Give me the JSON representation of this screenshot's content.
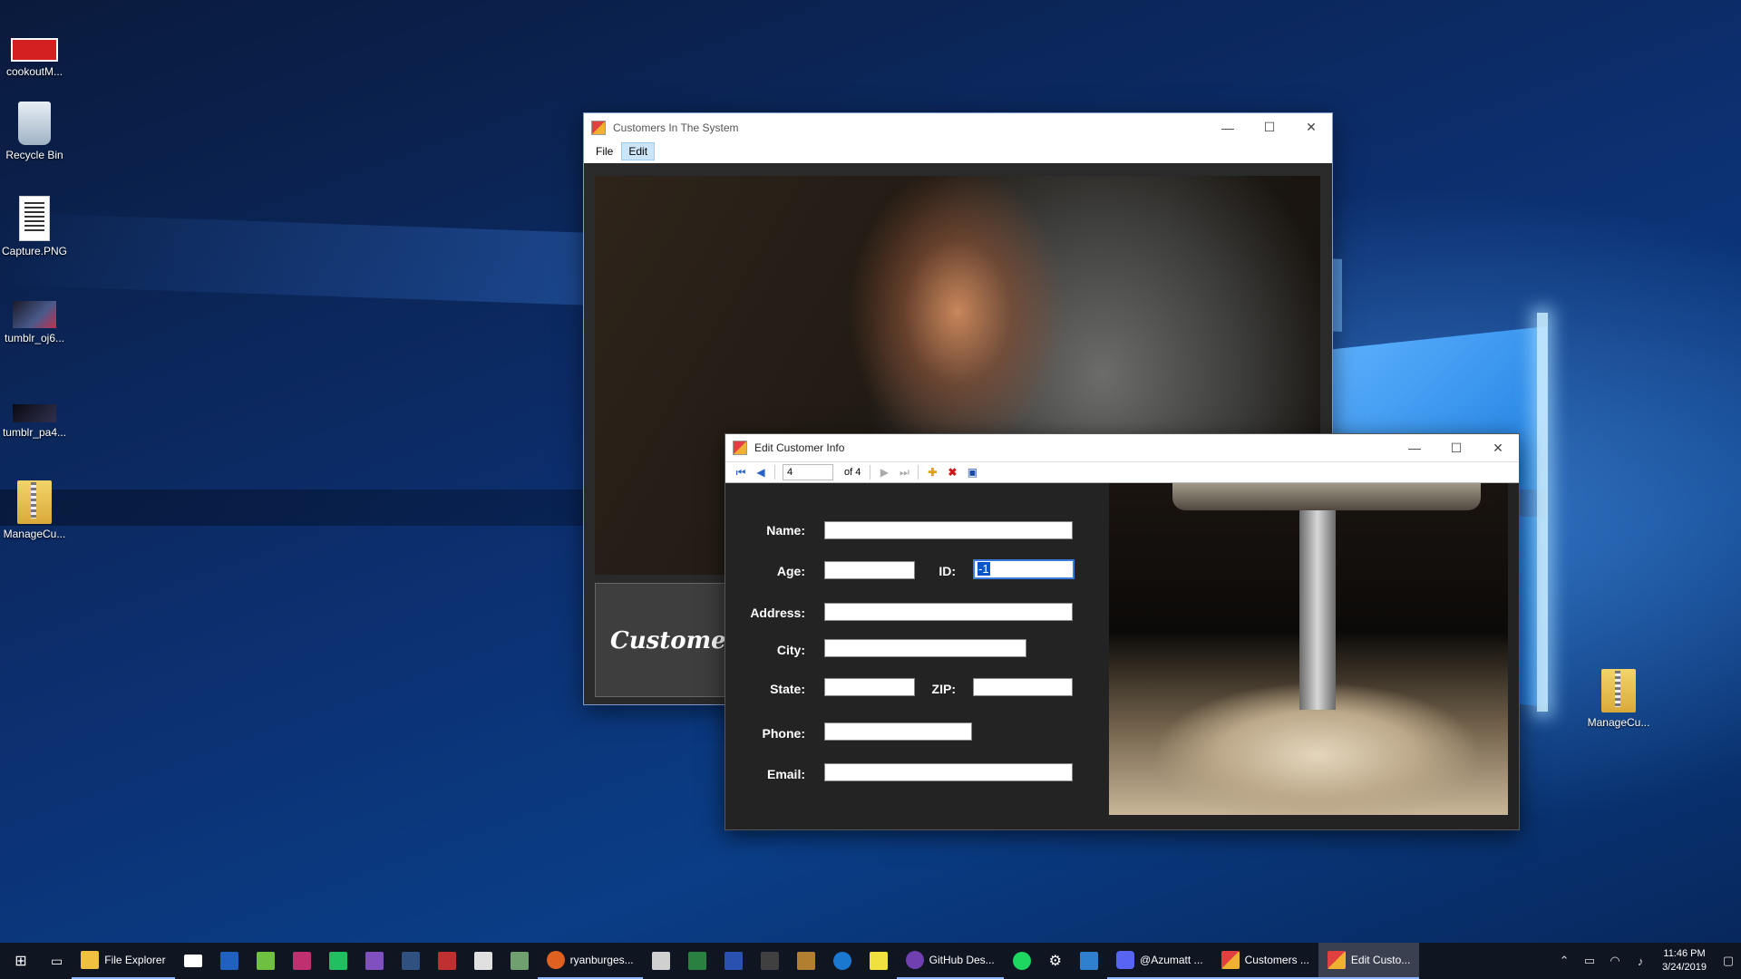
{
  "desktop": {
    "icons": [
      {
        "label": "cookoutM..."
      },
      {
        "label": "Recycle Bin"
      },
      {
        "label": "Capture.PNG"
      },
      {
        "label": "tumblr_oj6..."
      },
      {
        "label": "tumblr_pa4..."
      },
      {
        "label": "ManageCu..."
      }
    ],
    "right_icon": {
      "label": "ManageCu..."
    }
  },
  "main_window": {
    "title": "Customers In The System",
    "menu": [
      {
        "label": "File"
      },
      {
        "label": "Edit"
      }
    ],
    "banner_text": "Customers",
    "controls": {
      "minimize": "—",
      "maximize": "☐",
      "close": "✕"
    }
  },
  "edit_window": {
    "title": "Edit Customer Info",
    "nav": {
      "position": "4",
      "of_text": "of 4"
    },
    "fields": {
      "name": {
        "label": "Name:",
        "value": ""
      },
      "age": {
        "label": "Age:",
        "value": ""
      },
      "id": {
        "label": "ID:",
        "value": "-1"
      },
      "address": {
        "label": "Address:",
        "value": ""
      },
      "city": {
        "label": "City:",
        "value": ""
      },
      "state": {
        "label": "State:",
        "value": ""
      },
      "zip": {
        "label": "ZIP:",
        "value": ""
      },
      "phone": {
        "label": "Phone:",
        "value": ""
      },
      "email": {
        "label": "Email:",
        "value": ""
      }
    }
  },
  "taskbar": {
    "items": [
      {
        "label": "File Explorer"
      },
      {
        "label": "ryanburges..."
      },
      {
        "label": "GitHub Des..."
      },
      {
        "label": "@Azumatt ..."
      },
      {
        "label": "Customers ..."
      },
      {
        "label": "Edit Custo..."
      }
    ],
    "clock": {
      "time": "11:46 PM",
      "date": "3/24/2019"
    }
  },
  "colors": {
    "accent": "#0a55c8",
    "taskbar": "#101522",
    "dialog_bg": "#232323"
  }
}
